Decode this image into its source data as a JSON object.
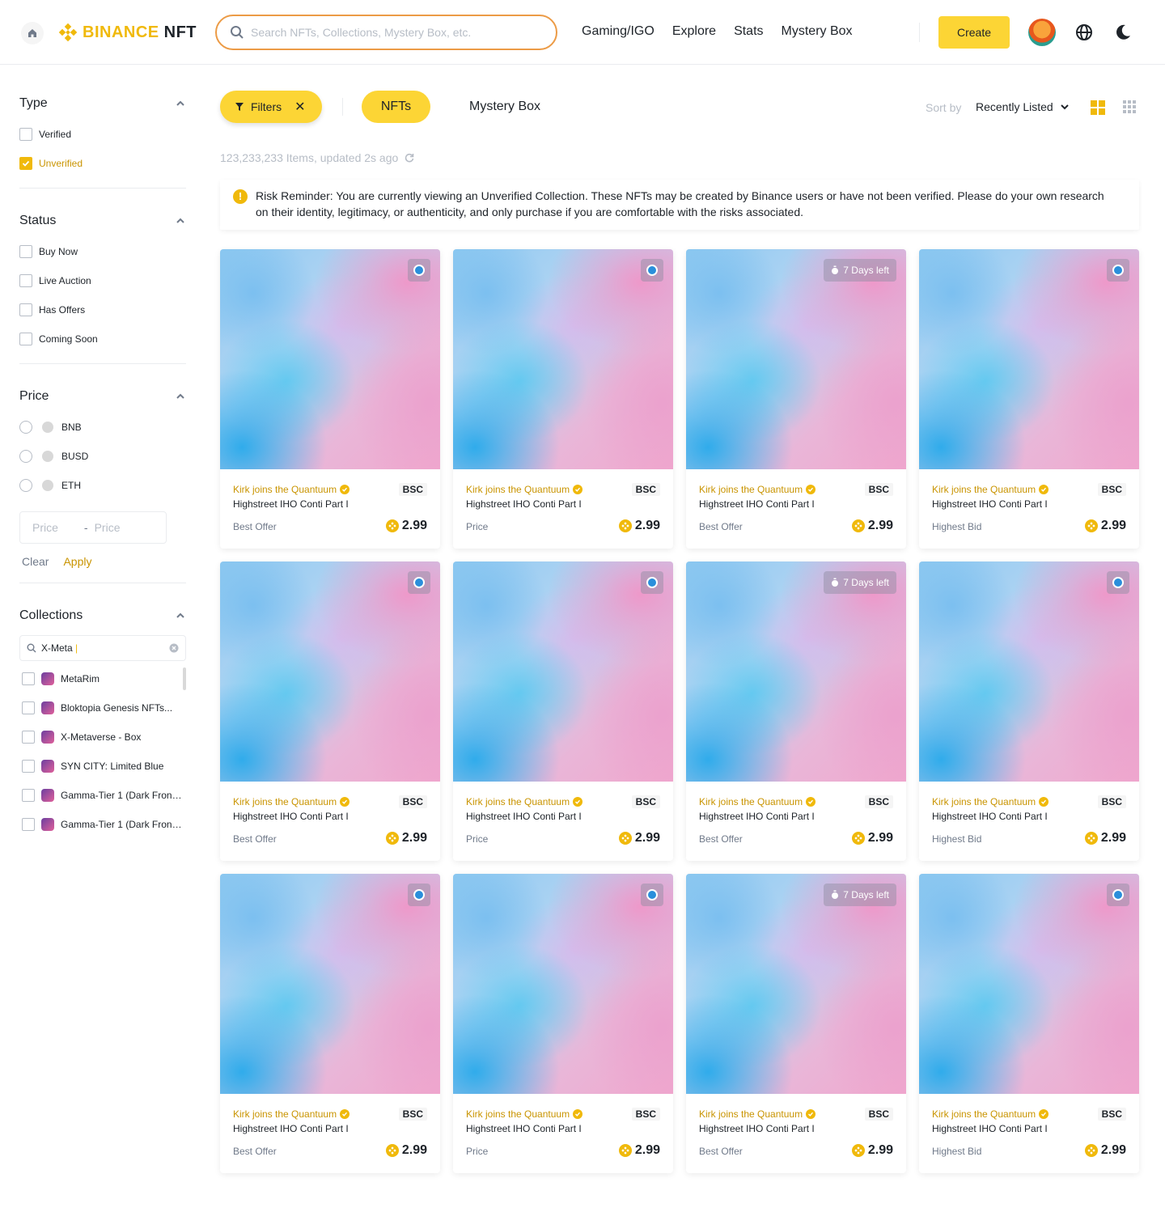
{
  "header": {
    "logo": "BINANCE",
    "logo_suffix": "NFT",
    "search_placeholder": "Search NFTs, Collections, Mystery Box, etc.",
    "nav": [
      "Gaming/IGO",
      "Explore",
      "Stats",
      "Mystery Box"
    ],
    "create_label": "Create"
  },
  "sidebar": {
    "type": {
      "title": "Type",
      "options": [
        {
          "label": "Verified",
          "checked": false
        },
        {
          "label": "Unverified",
          "checked": true
        }
      ]
    },
    "status": {
      "title": "Status",
      "options": [
        "Buy Now",
        "Live Auction",
        "Has Offers",
        "Coming Soon"
      ]
    },
    "price": {
      "title": "Price",
      "currencies": [
        "BNB",
        "BUSD",
        "ETH"
      ],
      "min_placeholder": "Price",
      "max_placeholder": "Price",
      "clear_label": "Clear",
      "apply_label": "Apply"
    },
    "collections": {
      "title": "Collections",
      "search_value": "X-Meta",
      "items": [
        "MetaRim",
        "Bloktopia Genesis NFTs...",
        "X-Metaverse - Box",
        "SYN CITY: Limited Blue",
        "Gamma-Tier 1 (Dark Front...",
        "Gamma-Tier 1 (Dark Front..."
      ]
    }
  },
  "toolbar": {
    "filters_label": "Filters",
    "tab_nfts": "NFTs",
    "tab_mystery": "Mystery Box",
    "sort_by_label": "Sort by",
    "sort_value": "Recently Listed",
    "items_count": "123,233,233 Items, updated 2s ago"
  },
  "risk_reminder": "Risk Reminder: You are currently viewing an Unverified Collection. These NFTs may be created by Binance users or have not been verified. Please do your own research on their identity, legitimacy, or authenticity, and only purchase if you are comfortable with the risks associated.",
  "colors": {
    "accent": "#FCD535",
    "brand": "#F0B90B",
    "link": "#C99400"
  },
  "cards": [
    {
      "collection": "Kirk joins the Quantuum",
      "chain": "BSC",
      "name": "Highstreet IHO Conti Part I",
      "price_label": "Best Offer",
      "price": "2.99",
      "badge": null
    },
    {
      "collection": "Kirk joins the Quantuum",
      "chain": "BSC",
      "name": "Highstreet IHO Conti Part I",
      "price_label": "Price",
      "price": "2.99",
      "badge": null
    },
    {
      "collection": "Kirk joins the Quantuum",
      "chain": "BSC",
      "name": "Highstreet IHO Conti Part I",
      "price_label": "Best Offer",
      "price": "2.99",
      "badge": "7 Days left"
    },
    {
      "collection": "Kirk joins the Quantuum",
      "chain": "BSC",
      "name": "Highstreet IHO Conti Part I",
      "price_label": "Highest Bid",
      "price": "2.99",
      "badge": null
    },
    {
      "collection": "Kirk joins the Quantuum",
      "chain": "BSC",
      "name": "Highstreet IHO Conti Part I",
      "price_label": "Best Offer",
      "price": "2.99",
      "badge": null
    },
    {
      "collection": "Kirk joins the Quantuum",
      "chain": "BSC",
      "name": "Highstreet IHO Conti Part I",
      "price_label": "Price",
      "price": "2.99",
      "badge": null
    },
    {
      "collection": "Kirk joins the Quantuum",
      "chain": "BSC",
      "name": "Highstreet IHO Conti Part I",
      "price_label": "Best Offer",
      "price": "2.99",
      "badge": "7 Days left"
    },
    {
      "collection": "Kirk joins the Quantuum",
      "chain": "BSC",
      "name": "Highstreet IHO Conti Part I",
      "price_label": "Highest Bid",
      "price": "2.99",
      "badge": null
    },
    {
      "collection": "Kirk joins the Quantuum",
      "chain": "BSC",
      "name": "Highstreet IHO Conti Part I",
      "price_label": "Best Offer",
      "price": "2.99",
      "badge": null
    },
    {
      "collection": "Kirk joins the Quantuum",
      "chain": "BSC",
      "name": "Highstreet IHO Conti Part I",
      "price_label": "Price",
      "price": "2.99",
      "badge": null
    },
    {
      "collection": "Kirk joins the Quantuum",
      "chain": "BSC",
      "name": "Highstreet IHO Conti Part I",
      "price_label": "Best Offer",
      "price": "2.99",
      "badge": "7 Days left"
    },
    {
      "collection": "Kirk joins the Quantuum",
      "chain": "BSC",
      "name": "Highstreet IHO Conti Part I",
      "price_label": "Highest Bid",
      "price": "2.99",
      "badge": null
    }
  ]
}
